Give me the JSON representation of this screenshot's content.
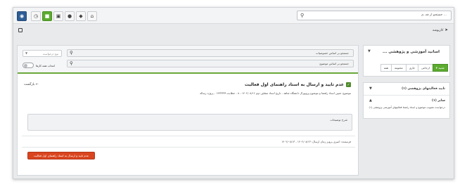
{
  "toolbar": {
    "search_placeholder": "جستجو از فه..ی ...",
    "buttons": [
      "user-icon-blue",
      "clock-icon",
      "folder-icon",
      "inbox-icon",
      "person-icon",
      "box-icon",
      "home-icon"
    ]
  },
  "breadcrumb": {
    "label": "کارپوشه"
  },
  "filters": {
    "search_features": "جستجو بر اساس خصوصیات",
    "search_subject": "جستجو بر اساس موضوع",
    "type_select": "نوع درخواست",
    "toggle_label": "انتخاب همه کارها"
  },
  "task": {
    "back_label": "بازگشت",
    "title": "عدم تایید و ارسال به استاد راهنمای اول فعالیت",
    "subline": "موضوع: تعیین استاد راهنما و موضوع پروپوزال دانشگاه شاهد - تاریخ استاد مشاور دوم ۱۴۰۲/۰۸/۱۶ - ۸ - خطابت ۱۴۳۳۳۳۹ - پروژه رساله",
    "description_label": "شرح توضیحات",
    "sender_line": "فرستنده: امیری پرویز  زمان ارسال: ۱۴۰۲/۰۸/۱۳ - ۱۴۰۲/۰۸/۱۳",
    "action_button": "عدم تایید و ارسال به استاد راهنمای اول فعالیت"
  },
  "side": {
    "profile_name": "... اساتید آموزشی و پژوهشی",
    "tabs": [
      "۲ جدید",
      "ارجاعی",
      "جاری",
      "مختومه",
      "همه"
    ],
    "section1": "تایید فعالیتهای پژوهشی (۱)",
    "section2": "سایر (۱)",
    "section2_item": "درخواست تصویب موضوع و استاد راهنما فعالیتهای آموزشی پژوهشی (۱)"
  },
  "colors": {
    "accent_green": "#5cab2f",
    "brand_blue": "#2d5d95",
    "action_red": "#d9451f"
  }
}
